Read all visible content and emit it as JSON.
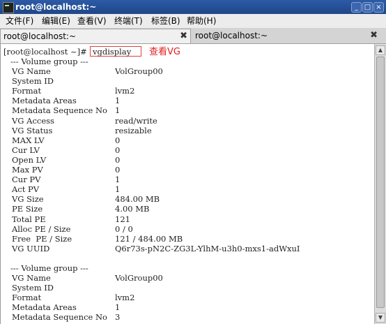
{
  "window": {
    "title": "root@localhost:~"
  },
  "menu": [
    "文件(F)",
    "编辑(E)",
    "查看(V)",
    "终端(T)",
    "标签(B)",
    "帮助(H)"
  ],
  "tabs": [
    {
      "label": "root@localhost:~",
      "close": "✖"
    },
    {
      "label": "root@localhost:~",
      "close": "✖"
    }
  ],
  "terminal": {
    "prompt": "[root@localhost ~]#",
    "command": "vgdisplay",
    "annotation": "查看VG",
    "group1_header": "--- Volume group ---",
    "group1": [
      {
        "k": "VG Name",
        "v": "VolGroup00"
      },
      {
        "k": "System ID",
        "v": ""
      },
      {
        "k": "Format",
        "v": "lvm2"
      },
      {
        "k": "Metadata Areas",
        "v": "1"
      },
      {
        "k": "Metadata Sequence No",
        "v": "1"
      },
      {
        "k": "VG Access",
        "v": "read/write"
      },
      {
        "k": "VG Status",
        "v": "resizable"
      },
      {
        "k": "MAX LV",
        "v": "0"
      },
      {
        "k": "Cur LV",
        "v": "0"
      },
      {
        "k": "Open LV",
        "v": "0"
      },
      {
        "k": "Max PV",
        "v": "0"
      },
      {
        "k": "Cur PV",
        "v": "1"
      },
      {
        "k": "Act PV",
        "v": "1"
      },
      {
        "k": "VG Size",
        "v": "484.00 MB"
      },
      {
        "k": "PE Size",
        "v": "4.00 MB"
      },
      {
        "k": "Total PE",
        "v": "121"
      },
      {
        "k": "Alloc PE / Size",
        "v": "0 / 0"
      },
      {
        "k": "Free  PE / Size",
        "v": "121 / 484.00 MB"
      },
      {
        "k": "VG UUID",
        "v": "Q6r73s-pN2C-ZG3L-YlhM-u3h0-mxs1-adWxuI"
      }
    ],
    "group2_header": "--- Volume group ---",
    "group2": [
      {
        "k": "VG Name",
        "v": "VolGroup00"
      },
      {
        "k": "System ID",
        "v": ""
      },
      {
        "k": "Format",
        "v": "lvm2"
      },
      {
        "k": "Metadata Areas",
        "v": "1"
      },
      {
        "k": "Metadata Sequence No",
        "v": "3"
      }
    ]
  }
}
